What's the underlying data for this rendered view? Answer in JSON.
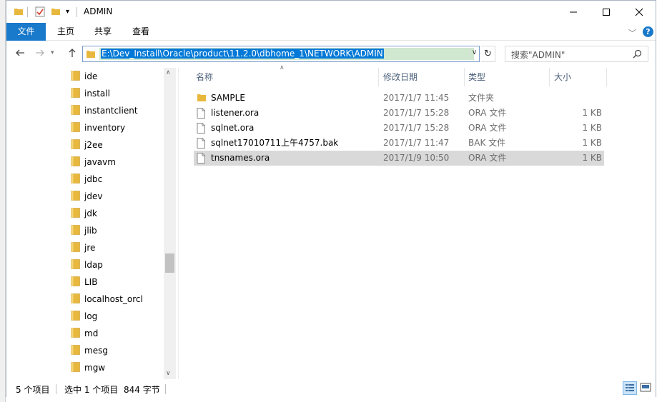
{
  "window": {
    "title": "ADMIN"
  },
  "ribbon": {
    "tabs": [
      "文件",
      "主页",
      "共享",
      "查看"
    ]
  },
  "address": {
    "path": "E:\\Dev_Install\\Oracle\\product\\11.2.0\\dbhome_1\\NETWORK\\ADMIN"
  },
  "search": {
    "placeholder": "搜索\"ADMIN\""
  },
  "nav_folders": [
    "ide",
    "install",
    "instantclient",
    "inventory",
    "j2ee",
    "javavm",
    "jdbc",
    "jdev",
    "jdk",
    "jlib",
    "jre",
    "ldap",
    "LIB",
    "localhost_orcl",
    "log",
    "md",
    "mesg",
    "mgw"
  ],
  "columns": {
    "name": "名称",
    "date": "修改日期",
    "type": "类型",
    "size": "大小"
  },
  "files": [
    {
      "name": "SAMPLE",
      "date": "2017/1/7 11:45",
      "type": "文件夹",
      "size": "",
      "kind": "folder",
      "selected": false
    },
    {
      "name": "listener.ora",
      "date": "2017/1/7 15:28",
      "type": "ORA 文件",
      "size": "1 KB",
      "kind": "file",
      "selected": false
    },
    {
      "name": "sqlnet.ora",
      "date": "2017/1/7 15:28",
      "type": "ORA 文件",
      "size": "1 KB",
      "kind": "file",
      "selected": false
    },
    {
      "name": "sqlnet17010711上午4757.bak",
      "date": "2017/1/7 11:47",
      "type": "BAK 文件",
      "size": "1 KB",
      "kind": "file",
      "selected": false
    },
    {
      "name": "tnsnames.ora",
      "date": "2017/1/9 10:50",
      "type": "ORA 文件",
      "size": "1 KB",
      "kind": "file",
      "selected": true
    }
  ],
  "status": {
    "item_count": "5 个项目",
    "selection": "选中 1 个项目",
    "selection_size": "844 字节"
  },
  "colors": {
    "accent": "#1979ca",
    "folder": "#e8b83e",
    "selection": "#d9d9d9",
    "address_highlight": "#0078d7"
  }
}
